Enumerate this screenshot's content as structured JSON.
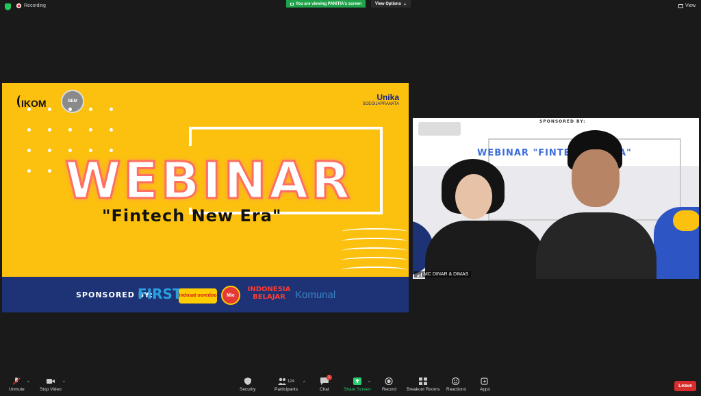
{
  "top": {
    "recording_label": "Recording",
    "viewing_banner": "You are viewing PANITIA's screen",
    "view_options": "View Options",
    "view_label": "View"
  },
  "slide": {
    "logo_text": "IKOM",
    "badge_text": "BEM",
    "unika": "Unika",
    "unika_sub": "SOEGIJAPRANATA",
    "title": "WEBINAR",
    "subtitle": "\"Fintech New Era\"",
    "sponsored_by": "SPONSORED BY:",
    "sponsors": [
      "FIRST",
      "Indosat ooredoo",
      "Mie",
      "INDONESIA BELAJAR",
      "Komunal"
    ]
  },
  "camera": {
    "sponsored_by": "SPONSORED BY:",
    "title": "WEBINAR \"FINTEC",
    "title_tail": "RA\"",
    "participant_name": "MC DINAR & DIMAS"
  },
  "toolbar": {
    "unmute": "Unmute",
    "stop_video": "Stop Video",
    "security": "Security",
    "participants": "Participants",
    "participants_count": "124",
    "chat": "Chat",
    "chat_badge": "1",
    "share_screen": "Share Screen",
    "record": "Record",
    "breakout_rooms": "Breakout Rooms",
    "reactions": "Reactions",
    "apps": "Apps",
    "leave": "Leave"
  },
  "colors": {
    "slide_bg": "#fcc10f",
    "slide_band": "#1d3375",
    "share_green": "#1fa34a",
    "leave_red": "#d92d2d"
  }
}
